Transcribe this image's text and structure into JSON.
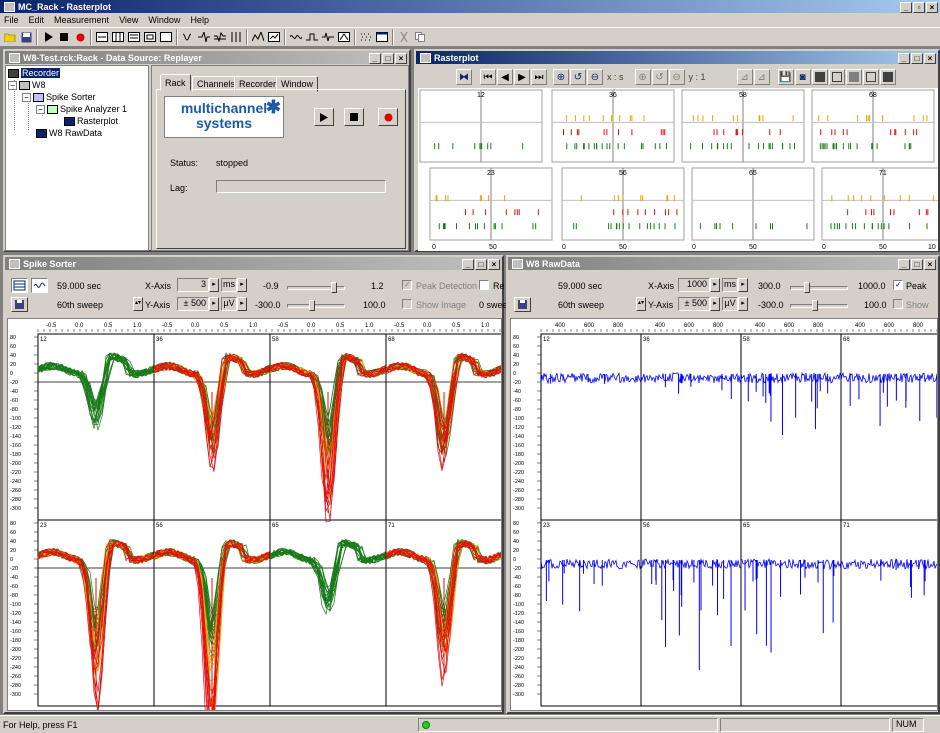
{
  "app": {
    "title": "MC_Rack - Rasterplot",
    "menu": [
      "File",
      "Edit",
      "Measurement",
      "View",
      "Window",
      "Help"
    ]
  },
  "rack_window": {
    "title": "W8-Test.rck:Rack - Data Source: Replayer",
    "tree": [
      {
        "label": "Recorder",
        "level": 0
      },
      {
        "label": "W8",
        "level": 0
      },
      {
        "label": "Spike Sorter",
        "level": 1
      },
      {
        "label": "Spike Analyzer 1",
        "level": 2
      },
      {
        "label": "Rasterplot",
        "level": 3
      },
      {
        "label": "W8 RawData",
        "level": 1
      }
    ],
    "tabs": [
      "Rack",
      "Channels",
      "Recorder",
      "Window"
    ],
    "logo_line1": "multichannel",
    "logo_line2": "systems",
    "status_label": "Status:",
    "status_value": "stopped",
    "lag_label": "Lag:"
  },
  "rasterplot": {
    "title": "Rasterplot",
    "x_label": "x : s",
    "y_label": "y : 1",
    "channels": [
      "12",
      "36",
      "58",
      "68",
      "23",
      "56",
      "65",
      "71"
    ],
    "x_ticks": [
      "0",
      "50",
      "0",
      "50",
      "0",
      "50",
      "0",
      "50",
      "10"
    ]
  },
  "spike_sorter": {
    "title": "Spike Sorter",
    "time": "59.000 sec",
    "sweep": "60th sweep",
    "x_axis_label": "X-Axis",
    "x_axis_value": "3",
    "x_unit": "ms",
    "y_axis_label": "Y-Axis",
    "y_axis_value": "± 500",
    "y_unit": "µV",
    "x_min": "-0.9",
    "x_max": "1.2",
    "y_min": "-300.0",
    "y_max": "100.0",
    "peak_detection": "Peak Detection",
    "re": "Re",
    "show_image": "Show Image",
    "sweeps": "0 swee",
    "channels": [
      "12",
      "36",
      "58",
      "68",
      "23",
      "56",
      "65",
      "71"
    ],
    "y_ticks": [
      "80",
      "60",
      "40",
      "20",
      "0",
      "-20",
      "-40",
      "-60",
      "-80",
      "-100",
      "-120",
      "-140",
      "-160",
      "-180",
      "-200",
      "-220",
      "-240",
      "-260",
      "-280",
      "-300"
    ],
    "x_ticks": [
      "-0.5",
      "0.0",
      "0.5",
      "1.0"
    ]
  },
  "raw_data": {
    "title": "W8 RawData",
    "time": "59.000 sec",
    "sweep": "60th sweep",
    "x_axis_label": "X-Axis",
    "x_axis_value": "1000",
    "x_unit": "ms",
    "y_axis_label": "Y-Axis",
    "y_axis_value": "± 500",
    "y_unit": "µV",
    "x_min": "300.0",
    "x_max": "1000.0",
    "y_min": "-300.0",
    "y_max": "100.0",
    "peak": "Peak",
    "show": "Show",
    "channels": [
      "12",
      "36",
      "58",
      "68",
      "23",
      "56",
      "65",
      "71"
    ],
    "x_ticks": [
      "400",
      "600",
      "800"
    ]
  },
  "statusbar": {
    "help": "For Help, press F1",
    "num": "NUM"
  },
  "colors": {
    "title_active": "#0a246a",
    "spike_green": "#1a7a1a",
    "spike_red": "#e01010",
    "spike_orange": "#f0a000",
    "raw_blue": "#0000ff"
  }
}
